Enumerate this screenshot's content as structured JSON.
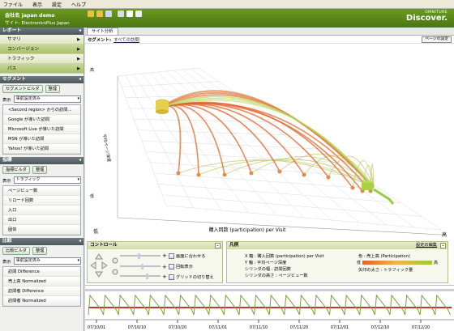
{
  "menu": [
    "ファイル",
    "表示",
    "設定",
    "ヘルプ"
  ],
  "header": {
    "company": "会社名 japan demo",
    "site": "サイト: ElectronicsPlus Japan",
    "logo_small": "OMNITURE",
    "logo_big": "Discover."
  },
  "sidebar": {
    "report_head": "レポート",
    "nav": [
      {
        "label": "サマリ",
        "active": false
      },
      {
        "label": "コンバージョン",
        "active": true
      },
      {
        "label": "トラフィック",
        "active": false
      },
      {
        "label": "パス",
        "active": true
      }
    ],
    "segment_head": "セグメント",
    "segment_builder": "セグメントビルダ",
    "organize": "整理",
    "show_label": "表示",
    "show_select": "事前設定済み",
    "segments": [
      "<Second region> からの訪問…",
      "Google が導いた訪問",
      "Microsoft Live が導いた訪問",
      "MSN が導いた訪問",
      "Yahoo! が導いた訪問"
    ],
    "metric_head": "指標",
    "metric_builder": "指標ビルダ",
    "metric_organize": "整理",
    "metric_show_label": "表示",
    "metric_select": "トラフィック",
    "metrics": [
      "ページビュー数",
      "リロード回数",
      "入口",
      "出口",
      "固体"
    ],
    "compare_head": "比較",
    "compare_builder": "比較ビルダ",
    "compare_organize": "整理",
    "compare_show_label": "表示",
    "compare_select": "事前設定済み",
    "compares": [
      "訪問 Difference",
      "売上高 Normalized",
      "訪問者 Difference",
      "訪問者 Normalized"
    ]
  },
  "main": {
    "tab": "サイト分析",
    "segment_label": "セグメント:",
    "segment_value": "すべての訪問",
    "page_setting": "ページの設定"
  },
  "chart_data": {
    "type": "3d-path",
    "xlabel": "購入回数 (participation) per Visit",
    "ylabel": "平均ページ深度",
    "x_low": "低",
    "x_high": "高",
    "y_low": "低",
    "y_high": "高"
  },
  "controls": {
    "head": "コントロール",
    "fit": "画面に合わせる",
    "rotate": "回転表示",
    "grid": "グリッドの切り替え"
  },
  "legend": {
    "head": "凡例",
    "edit": "設定の編集",
    "x": "X 軸 : 購入回数 (participation) per Visit",
    "y": "Y 軸 : 平均ページ深度",
    "cyl_width": "シリンダの幅 : 訪問回数",
    "cyl_height": "シリンダの高さ : ページビュー数",
    "color": "色 : 売上高 (Participation)",
    "color_low": "低",
    "color_high": "高",
    "arrow": "矢印の太さ : トラフィック量"
  },
  "timeline": {
    "dates": [
      "07/10/01",
      "07/10/10",
      "07/10/20",
      "07/11/01",
      "07/11/10",
      "07/11/20",
      "07/12/01",
      "07/12/10",
      "07/12/20"
    ]
  },
  "colors": {
    "brand": "#5b8a1a",
    "path_orange": "#e0642a",
    "path_green": "#9acc3a"
  }
}
